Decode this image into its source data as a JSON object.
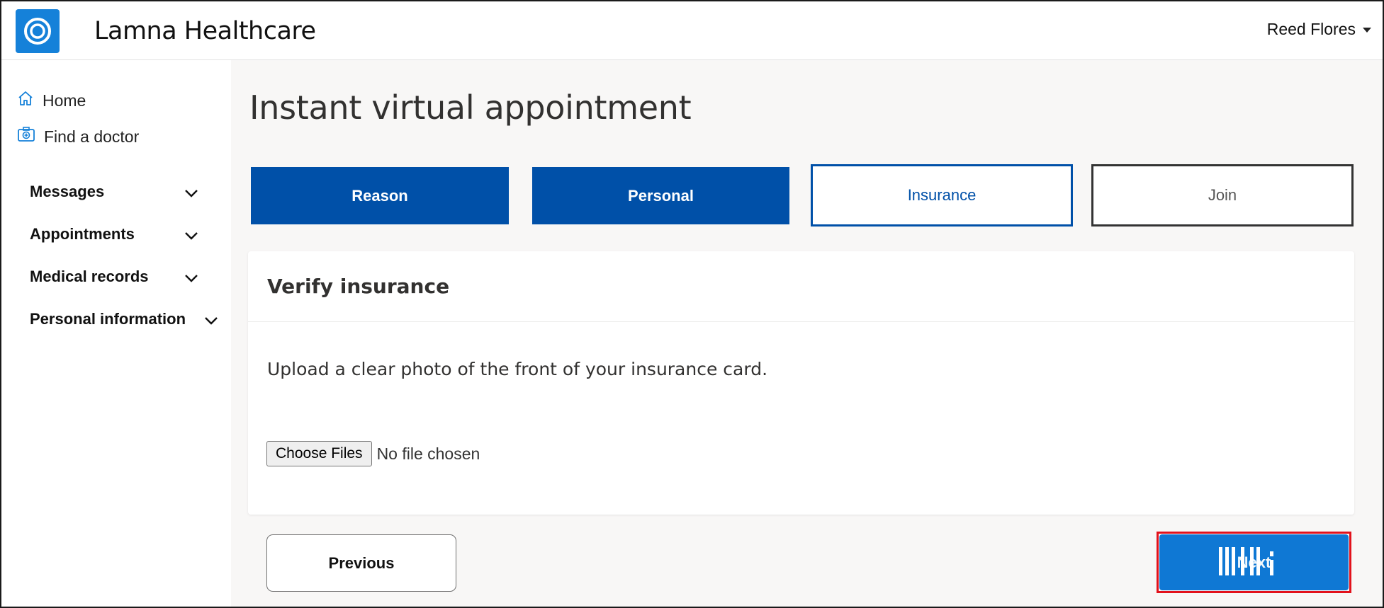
{
  "header": {
    "app_title": "Lamna Healthcare",
    "user_name": "Reed Flores",
    "logo_icon": "ring-logo-icon",
    "brand_color": "#1581d9"
  },
  "sidebar": {
    "links": [
      {
        "label": "Home",
        "icon": "home-icon"
      },
      {
        "label": "Find a doctor",
        "icon": "doctor-search-icon"
      }
    ],
    "groups": [
      {
        "label": "Messages"
      },
      {
        "label": "Appointments"
      },
      {
        "label": "Medical records"
      },
      {
        "label": "Personal information"
      }
    ]
  },
  "main": {
    "page_title": "Instant virtual appointment",
    "steps": [
      {
        "label": "Reason",
        "state": "complete"
      },
      {
        "label": "Personal",
        "state": "complete"
      },
      {
        "label": "Insurance",
        "state": "current"
      },
      {
        "label": "Join",
        "state": "upcoming"
      }
    ],
    "card": {
      "title": "Verify insurance",
      "instruction": "Upload a clear photo of the front of your insurance card.",
      "file_button": "Choose Files",
      "file_status": "No file chosen"
    },
    "buttons": {
      "previous": "Previous",
      "next": "Next"
    }
  },
  "colors": {
    "step_complete": "#0050a8",
    "primary_button": "#0f78d4",
    "highlight_outline": "#e2121c"
  }
}
